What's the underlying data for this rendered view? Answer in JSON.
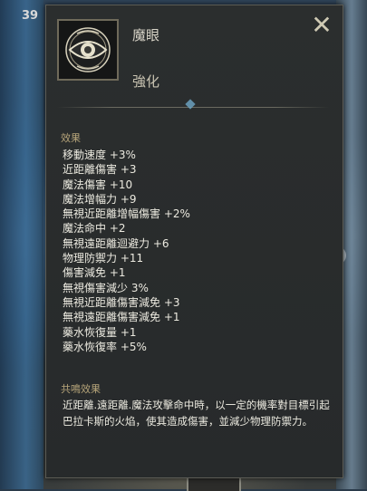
{
  "hud": {
    "level": "39"
  },
  "tooltip": {
    "item_name": "魔眼",
    "item_type": "強化",
    "effects_label": "效果",
    "effects": [
      "移動速度 +3%",
      "近距離傷害 +3",
      "魔法傷害 +10",
      "魔法增幅力 +9",
      "無視近距離增幅傷害 +2%",
      "魔法命中 +2",
      "無視遠距離迴避力 +6",
      "物理防禦力 +11",
      "傷害減免 +1",
      "無視傷害減少 3%",
      "無視近距離傷害減免 +3",
      "無視遠距離傷害減免 +1",
      "藥水恢復量 +1",
      "藥水恢復率 +5%"
    ],
    "resonance_label": "共鳴效果",
    "resonance_text": "近距離.遠距離.魔法攻擊命中時，以一定的機率對目標引起巴拉卡斯的火焰，使其造成傷害，並減少物理防禦力。",
    "close_icon": "close-icon",
    "item_icon": "eye-icon"
  }
}
